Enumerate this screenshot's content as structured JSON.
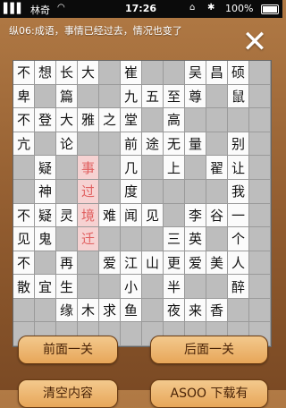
{
  "status": {
    "signal": "▌▌▌",
    "carrier": "林奇",
    "wifi": "wifi",
    "time": "17:26",
    "lock": "lock",
    "bt": "bluetooth",
    "battery": "100%"
  },
  "header": {
    "clue": "纵06:成语，事情已经过去，情况也变了",
    "close_icon": "✕"
  },
  "board": [
    [
      "不",
      "想",
      "长",
      "大",
      "",
      "崔",
      "",
      "",
      "吴",
      "昌",
      "硕",
      ""
    ],
    [
      "卑",
      "",
      "篇",
      "",
      "",
      "九",
      "五",
      "至",
      "尊",
      "",
      "鼠",
      ""
    ],
    [
      "不",
      "登",
      "大",
      "雅",
      "之",
      "堂",
      "",
      "高",
      "",
      "",
      "",
      ""
    ],
    [
      "亢",
      "",
      "论",
      "",
      "",
      "前",
      "途",
      "无",
      "量",
      "",
      "别",
      ""
    ],
    [
      "",
      "疑",
      "",
      "事",
      "",
      "几",
      "",
      "上",
      "",
      "翟",
      "让",
      ""
    ],
    [
      "",
      "神",
      "",
      "过",
      "",
      "度",
      "",
      "",
      "",
      "",
      "我",
      ""
    ],
    [
      "不",
      "疑",
      "灵",
      "境",
      "难",
      "闻",
      "见",
      "",
      "李",
      "谷",
      "一",
      ""
    ],
    [
      "见",
      "鬼",
      "",
      "迁",
      "",
      "",
      "",
      "三",
      "英",
      "",
      "个",
      ""
    ],
    [
      "不",
      "",
      "再",
      "",
      "爱",
      "江",
      "山",
      "更",
      "爱",
      "美",
      "人",
      ""
    ],
    [
      "散",
      "宜",
      "生",
      "",
      "",
      "小",
      "",
      "半",
      "",
      "",
      "醉",
      ""
    ],
    [
      "",
      "",
      "缘",
      "木",
      "求",
      "鱼",
      "",
      "夜",
      "来",
      "香",
      "",
      ""
    ],
    [
      "",
      "",
      "",
      "",
      "",
      "",
      "",
      "",
      "",
      "",
      "",
      ""
    ]
  ],
  "highlight": [
    [
      4,
      3
    ],
    [
      5,
      3
    ],
    [
      6,
      3
    ],
    [
      7,
      3
    ]
  ],
  "buttons": {
    "prev": "前面一关",
    "next": "后面一关",
    "clear": "清空内容",
    "tips": "ASOO 下载有"
  }
}
